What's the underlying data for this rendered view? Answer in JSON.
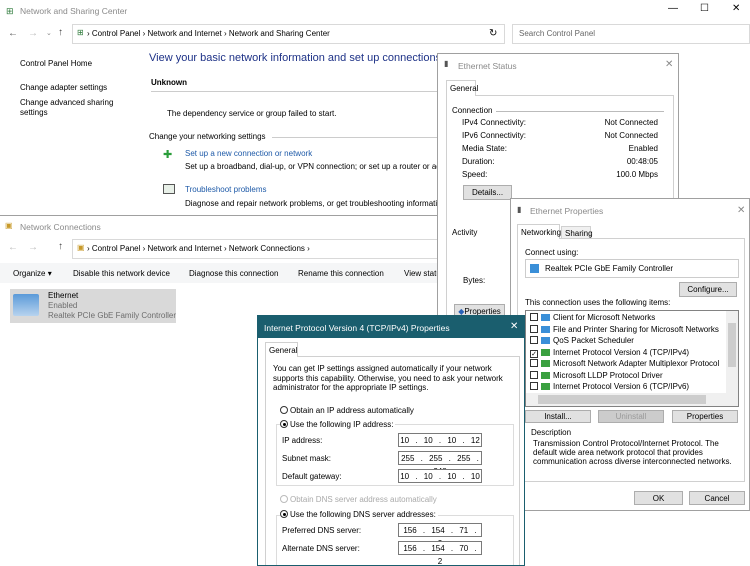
{
  "nsc": {
    "title": "Network and Sharing Center",
    "breadcrumb": [
      "Control Panel",
      "Network and Internet",
      "Network and Sharing Center"
    ],
    "search_placeholder": "Search Control Panel",
    "sidebar": [
      "Control Panel Home",
      "Change adapter settings",
      "Change advanced sharing settings"
    ],
    "heading": "View your basic network information and set up connections",
    "network_name": "Unknown",
    "error": "The dependency service or group failed to start.",
    "change_heading": "Change your networking settings",
    "tasks": [
      {
        "label": "Set up a new connection or network",
        "desc": "Set up a broadband, dial-up, or VPN connection; or set up a router or access point."
      },
      {
        "label": "Troubleshoot problems",
        "desc": "Diagnose and repair network problems, or get troubleshooting information."
      }
    ]
  },
  "nc": {
    "title": "Network Connections",
    "breadcrumb": [
      "Control Panel",
      "Network and Internet",
      "Network Connections"
    ],
    "toolbar": [
      "Organize",
      "Disable this network device",
      "Diagnose this connection",
      "Rename this connection",
      "View status of this connection"
    ],
    "item": {
      "name": "Ethernet",
      "status": "Enabled",
      "device": "Realtek PCIe GbE Family Controller"
    }
  },
  "status": {
    "title": "Ethernet Status",
    "tab": "General",
    "connection_label": "Connection",
    "rows": [
      {
        "k": "IPv4 Connectivity:",
        "v": "Not Connected"
      },
      {
        "k": "IPv6 Connectivity:",
        "v": "Not Connected"
      },
      {
        "k": "Media State:",
        "v": "Enabled"
      },
      {
        "k": "Duration:",
        "v": "00:48:05"
      },
      {
        "k": "Speed:",
        "v": "100.0 Mbps"
      }
    ],
    "details": "Details...",
    "activity": "Activity",
    "bytes": "Bytes:",
    "properties": "Properties"
  },
  "props": {
    "title": "Ethernet Properties",
    "tabs": [
      "Networking",
      "Sharing"
    ],
    "connect_using": "Connect using:",
    "adapter": "Realtek PCIe GbE Family Controller",
    "configure": "Configure...",
    "items_label": "This connection uses the following items:",
    "items": [
      {
        "label": "Client for Microsoft Networks",
        "checked": false
      },
      {
        "label": "File and Printer Sharing for Microsoft Networks",
        "checked": false
      },
      {
        "label": "QoS Packet Scheduler",
        "checked": false
      },
      {
        "label": "Internet Protocol Version 4 (TCP/IPv4)",
        "checked": true
      },
      {
        "label": "Microsoft Network Adapter Multiplexor Protocol",
        "checked": false
      },
      {
        "label": "Microsoft LLDP Protocol Driver",
        "checked": false
      },
      {
        "label": "Internet Protocol Version 6 (TCP/IPv6)",
        "checked": false
      }
    ],
    "install": "Install...",
    "uninstall": "Uninstall",
    "properties": "Properties",
    "description_label": "Description",
    "description": "Transmission Control Protocol/Internet Protocol. The default wide area network protocol that provides communication across diverse interconnected networks.",
    "ok": "OK",
    "cancel": "Cancel"
  },
  "ipv4": {
    "title": "Internet Protocol Version 4 (TCP/IPv4) Properties",
    "tab": "General",
    "intro": "You can get IP settings assigned automatically if your network supports this capability. Otherwise, you need to ask your network administrator for the appropriate IP settings.",
    "auto_ip": "Obtain an IP address automatically",
    "manual_ip": "Use the following IP address:",
    "ip_label": "IP address:",
    "ip": "10 . 10 . 10 . 12",
    "mask_label": "Subnet mask:",
    "mask": "255 . 255 . 255 . 248",
    "gw_label": "Default gateway:",
    "gw": "10 . 10 . 10 . 10",
    "auto_dns": "Obtain DNS server address automatically",
    "manual_dns": "Use the following DNS server addresses:",
    "dns1_label": "Preferred DNS server:",
    "dns1": "156 . 154 . 71 . 2",
    "dns2_label": "Alternate DNS server:",
    "dns2": "156 . 154 . 70 . 2"
  },
  "colors": {
    "link": "#1e5aa8",
    "heading": "#1e3287",
    "dialog_title": "#1a5e6e"
  }
}
